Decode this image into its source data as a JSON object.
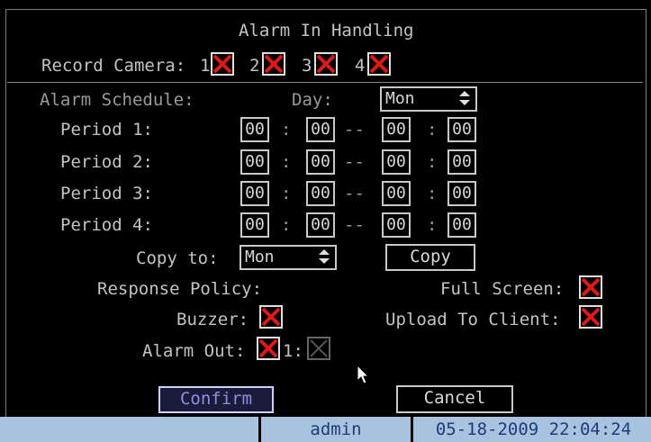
{
  "title": "Alarm In Handling",
  "record_camera": {
    "label": "Record Camera:",
    "cameras": [
      {
        "num": "1",
        "checked": true
      },
      {
        "num": "2",
        "checked": true
      },
      {
        "num": "3",
        "checked": true
      },
      {
        "num": "4",
        "checked": true
      }
    ]
  },
  "schedule": {
    "label": "Alarm Schedule:",
    "day_label": "Day:",
    "day_value": "Mon",
    "periods": [
      {
        "label": "Period 1:",
        "start_h": "00",
        "start_m": "00",
        "end_h": "00",
        "end_m": "00"
      },
      {
        "label": "Period 2:",
        "start_h": "00",
        "start_m": "00",
        "end_h": "00",
        "end_m": "00"
      },
      {
        "label": "Period 3:",
        "start_h": "00",
        "start_m": "00",
        "end_h": "00",
        "end_m": "00"
      },
      {
        "label": "Period 4:",
        "start_h": "00",
        "start_m": "00",
        "end_h": "00",
        "end_m": "00"
      }
    ],
    "colon": ":",
    "dash": "--",
    "copy_to_label": "Copy to:",
    "copy_to_value": "Mon",
    "copy_button": "Copy"
  },
  "response_policy": {
    "label": "Response Policy:",
    "full_screen_label": "Full Screen:",
    "full_screen_checked": true,
    "buzzer_label": "Buzzer:",
    "buzzer_checked": true,
    "upload_label": "Upload To Client:",
    "upload_checked": true,
    "alarm_out_label": "Alarm Out:",
    "alarm_out_checked": true,
    "alarm_out_1_label": "1:",
    "alarm_out_1_checked": false
  },
  "buttons": {
    "confirm": "Confirm",
    "cancel": "Cancel"
  },
  "status_bar": {
    "user": "admin",
    "datetime": "05-18-2009 22:04:24"
  },
  "colors": {
    "check_red": "#e01818",
    "status_bg": "#a9c2de",
    "status_text": "#1d3c7a"
  }
}
